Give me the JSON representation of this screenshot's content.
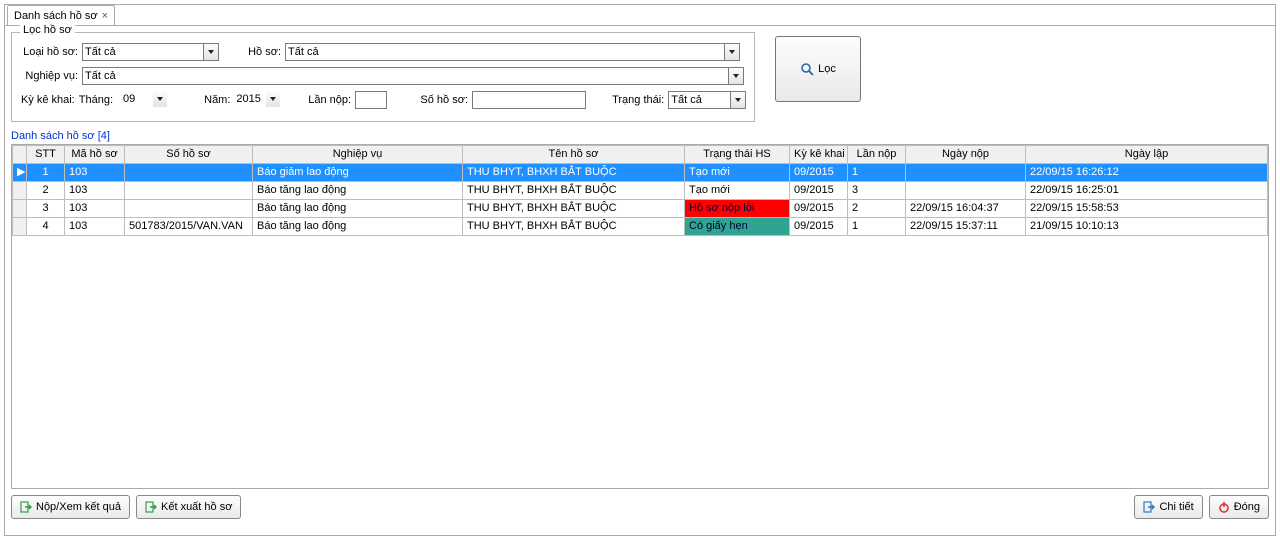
{
  "tab": {
    "title": "Danh sách hồ sơ",
    "close_tooltip": "Close"
  },
  "filter": {
    "legend": "Lọc hồ sơ",
    "loai_label": "Loại hồ sơ:",
    "loai_value": "Tất cả",
    "hoso_label": "Hồ sơ:",
    "hoso_value": "Tất cả",
    "nghiepvu_label": "Nghiệp vụ:",
    "nghiepvu_value": "Tất cả",
    "kykk_label": "Kỳ kê khai:",
    "thang_label": "Tháng:",
    "thang_value": "09",
    "nam_label": "Năm:",
    "nam_value": "2015",
    "lannop_label": "Lần nộp:",
    "lannop_value": "",
    "sohs_label": "Số hồ sơ:",
    "sohs_value": "",
    "trangthai_label": "Trạng thái:",
    "trangthai_value": "Tất cả",
    "loc_label": "Lọc"
  },
  "subtitle": "Danh sách hồ sơ [4]",
  "table": {
    "headers": [
      "STT",
      "Mã hồ sơ",
      "Số hồ sơ",
      "Nghiệp vụ",
      "Tên hồ sơ",
      "Trạng thái HS",
      "Kỳ kê khai",
      "Lần nộp",
      "Ngày nộp",
      "Ngày lập"
    ],
    "rows": [
      {
        "selected": true,
        "stt": "1",
        "ma": "103",
        "sohs": "",
        "nv": "Báo giảm lao động",
        "ten": "THU BHYT, BHXH BẮT BUỘC",
        "tt": "Tạo mới",
        "tt_class": "",
        "ky": "09/2015",
        "lan": "1",
        "ngaynop": "",
        "ngaylap": "22/09/15 16:26:12"
      },
      {
        "selected": false,
        "stt": "2",
        "ma": "103",
        "sohs": "",
        "nv": "Báo tăng lao động",
        "ten": "THU BHYT, BHXH BẮT BUỘC",
        "tt": "Tạo mới",
        "tt_class": "",
        "ky": "09/2015",
        "lan": "3",
        "ngaynop": "",
        "ngaylap": "22/09/15 16:25:01"
      },
      {
        "selected": false,
        "stt": "3",
        "ma": "103",
        "sohs": "",
        "nv": "Báo tăng lao động",
        "ten": "THU BHYT, BHXH BẮT BUỘC",
        "tt": "Hồ sơ nộp lỗi",
        "tt_class": "st-red",
        "ky": "09/2015",
        "lan": "2",
        "ngaynop": "22/09/15 16:04:37",
        "ngaylap": "22/09/15 15:58:53"
      },
      {
        "selected": false,
        "stt": "4",
        "ma": "103",
        "sohs": "501783/2015/VAN.VAN",
        "nv": "Báo tăng lao động",
        "ten": "THU BHYT, BHXH BẮT BUỘC",
        "tt": "Có giấy hẹn",
        "tt_class": "st-green",
        "ky": "09/2015",
        "lan": "1",
        "ngaynop": "22/09/15 15:37:11",
        "ngaylap": "21/09/15 10:10:13"
      }
    ]
  },
  "footer": {
    "nopxem": "Nộp/Xem kết quả",
    "ketxuat": "Kết xuất hồ sơ",
    "chitiet": "Chi tiết",
    "dong": "Đóng"
  }
}
